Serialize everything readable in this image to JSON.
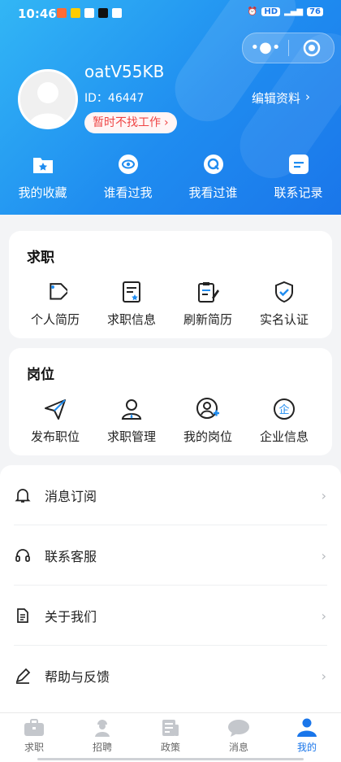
{
  "status_bar": {
    "time": "10:46",
    "battery": "76"
  },
  "profile": {
    "username": "oatV55KB",
    "id_text": "ID：46447",
    "job_status": "暂时不找工作",
    "edit_label": "编辑资料"
  },
  "quick_actions": [
    {
      "label": "我的收藏",
      "icon": "star-folder-icon"
    },
    {
      "label": "谁看过我",
      "icon": "eye-icon"
    },
    {
      "label": "我看过谁",
      "icon": "search-q-icon"
    },
    {
      "label": "联系记录",
      "icon": "message-icon"
    }
  ],
  "job_seeking": {
    "title": "求职",
    "items": [
      {
        "label": "个人简历",
        "icon": "tag-icon"
      },
      {
        "label": "求职信息",
        "icon": "document-star-icon"
      },
      {
        "label": "刷新简历",
        "icon": "clipboard-edit-icon"
      },
      {
        "label": "实名认证",
        "icon": "shield-check-icon"
      }
    ]
  },
  "positions": {
    "title": "岗位",
    "items": [
      {
        "label": "发布职位",
        "icon": "send-icon"
      },
      {
        "label": "求职管理",
        "icon": "user-tie-icon"
      },
      {
        "label": "我的岗位",
        "icon": "user-add-icon"
      },
      {
        "label": "企业信息",
        "icon": "enterprise-icon"
      }
    ]
  },
  "menu": [
    {
      "label": "消息订阅",
      "icon": "bell-icon"
    },
    {
      "label": "联系客服",
      "icon": "headset-icon"
    },
    {
      "label": "关于我们",
      "icon": "document-icon"
    },
    {
      "label": "帮助与反馈",
      "icon": "feedback-icon"
    }
  ],
  "tabbar": [
    {
      "label": "求职",
      "icon": "briefcase-icon",
      "active": false
    },
    {
      "label": "招聘",
      "icon": "worker-icon",
      "active": false
    },
    {
      "label": "政策",
      "icon": "newspaper-icon",
      "active": false
    },
    {
      "label": "消息",
      "icon": "chat-icon",
      "active": false
    },
    {
      "label": "我的",
      "icon": "user-icon",
      "active": true
    }
  ],
  "colors": {
    "primary": "#1a76ea",
    "accent_red": "#ef4444",
    "header_light": "#32b6f5"
  }
}
